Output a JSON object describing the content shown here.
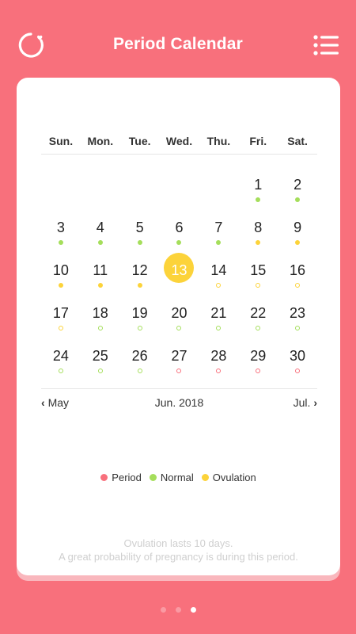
{
  "header": {
    "title": "Period Calendar",
    "logo_icon": "circle-heart-icon",
    "menu_icon": "list-menu-icon"
  },
  "calendar": {
    "weekdays": [
      "Sun.",
      "Mon.",
      "Tue.",
      "Wed.",
      "Thu.",
      "Fri.",
      "Sat."
    ],
    "leading_blank_days": 5,
    "today": 13,
    "days": [
      {
        "d": "1",
        "dot": "normal-filled"
      },
      {
        "d": "2",
        "dot": "normal-filled"
      },
      {
        "d": "3",
        "dot": "normal-filled"
      },
      {
        "d": "4",
        "dot": "normal-filled"
      },
      {
        "d": "5",
        "dot": "normal-filled"
      },
      {
        "d": "6",
        "dot": "normal-filled"
      },
      {
        "d": "7",
        "dot": "normal-filled"
      },
      {
        "d": "8",
        "dot": "ovulation-filled"
      },
      {
        "d": "9",
        "dot": "ovulation-filled"
      },
      {
        "d": "10",
        "dot": "ovulation-filled"
      },
      {
        "d": "11",
        "dot": "ovulation-filled"
      },
      {
        "d": "12",
        "dot": "ovulation-filled"
      },
      {
        "d": "13",
        "dot": "none"
      },
      {
        "d": "14",
        "dot": "ovulation-outline"
      },
      {
        "d": "15",
        "dot": "ovulation-outline"
      },
      {
        "d": "16",
        "dot": "ovulation-outline"
      },
      {
        "d": "17",
        "dot": "ovulation-outline"
      },
      {
        "d": "18",
        "dot": "normal-outline"
      },
      {
        "d": "19",
        "dot": "normal-outline"
      },
      {
        "d": "20",
        "dot": "normal-outline"
      },
      {
        "d": "21",
        "dot": "normal-outline"
      },
      {
        "d": "22",
        "dot": "normal-outline"
      },
      {
        "d": "23",
        "dot": "normal-outline"
      },
      {
        "d": "24",
        "dot": "normal-outline"
      },
      {
        "d": "25",
        "dot": "normal-outline"
      },
      {
        "d": "26",
        "dot": "normal-outline"
      },
      {
        "d": "27",
        "dot": "period-outline"
      },
      {
        "d": "28",
        "dot": "period-outline"
      },
      {
        "d": "29",
        "dot": "period-outline"
      },
      {
        "d": "30",
        "dot": "period-outline"
      }
    ]
  },
  "nav": {
    "prev_label": "May",
    "current_label": "Jun. 2018",
    "next_label": "Jul."
  },
  "legend": [
    {
      "label": "Period",
      "color": "#f8707c"
    },
    {
      "label": "Normal",
      "color": "#a5de5b"
    },
    {
      "label": "Ovulation",
      "color": "#fcd33a"
    }
  ],
  "notes": {
    "line1": "Ovulation lasts 10 days.",
    "line2": "A great probability of pregnancy is during this period."
  },
  "pager": {
    "count": 3,
    "active": 2
  },
  "colors": {
    "background": "#f8707c",
    "period": "#f8707c",
    "normal": "#a5de5b",
    "ovulation": "#fcd33a",
    "today": "#fcd33a"
  }
}
